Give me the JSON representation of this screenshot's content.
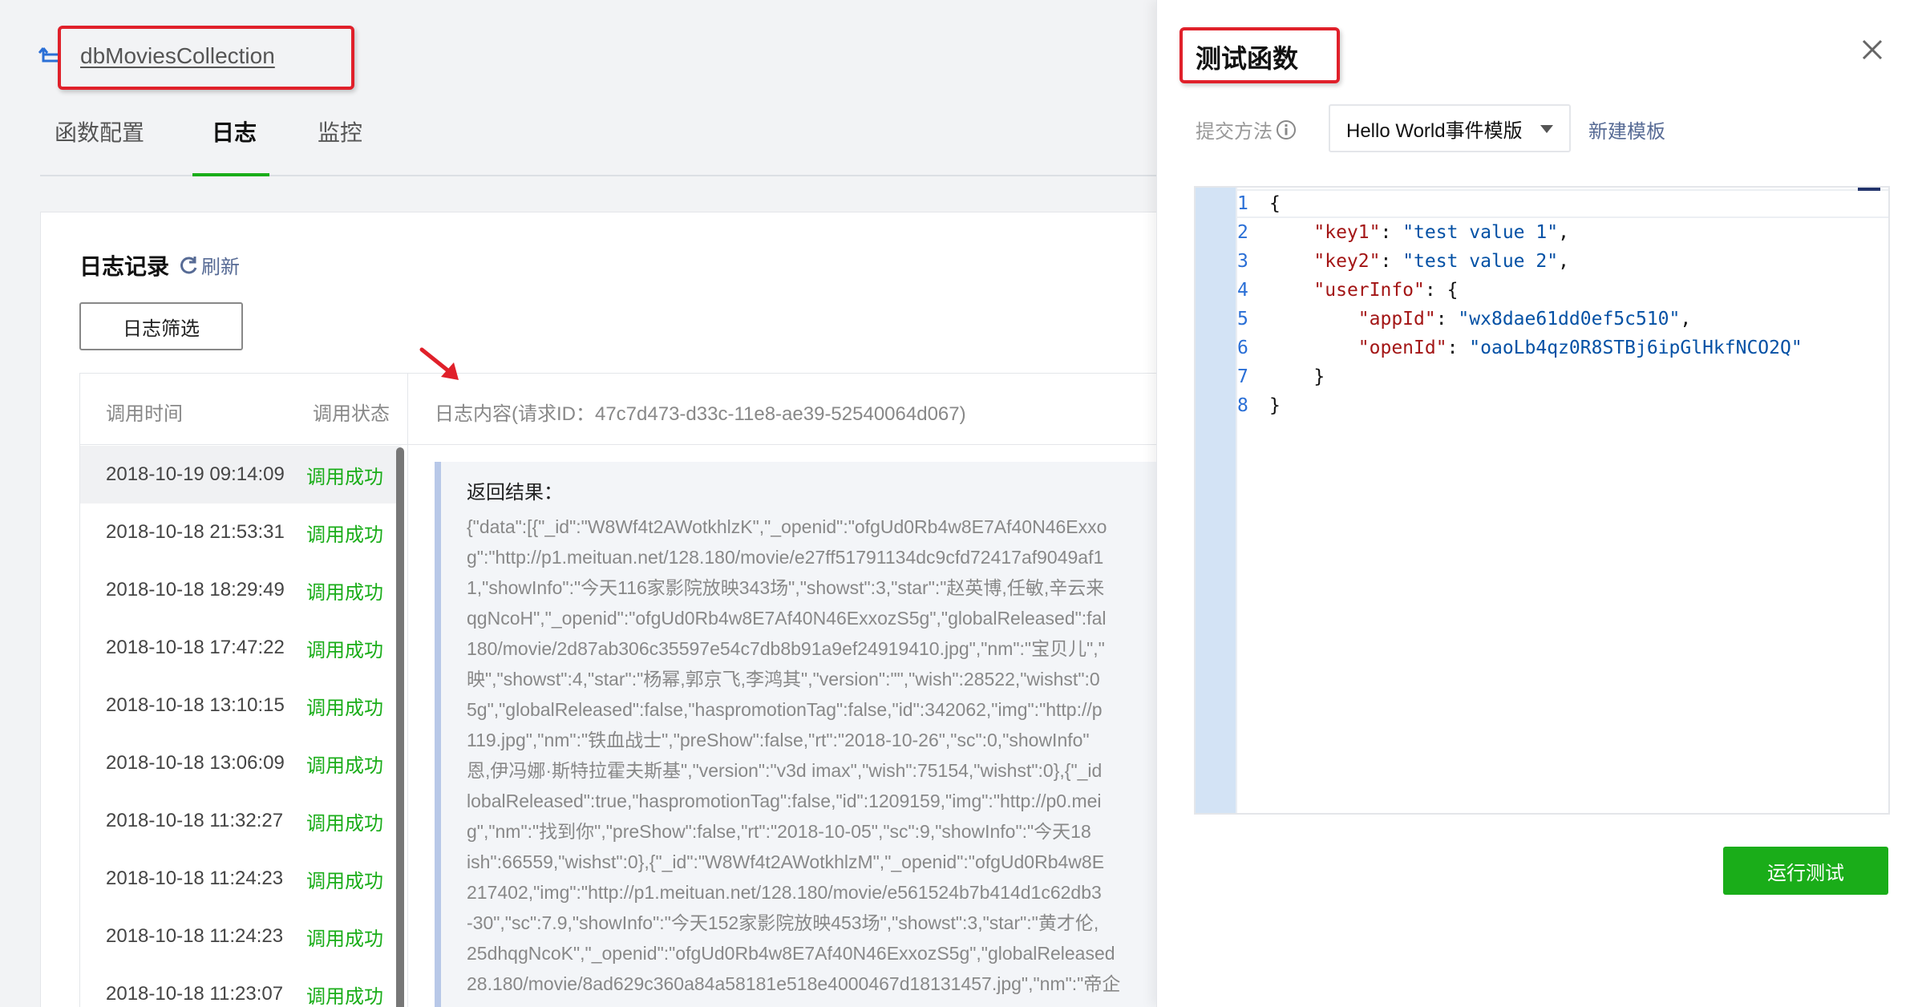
{
  "header": {
    "function_name": "dbMoviesCollection"
  },
  "tabs": [
    {
      "label": "函数配置"
    },
    {
      "label": "日志"
    },
    {
      "label": "监控"
    }
  ],
  "active_tab": "日志",
  "log_section": {
    "title": "日志记录",
    "refresh_label": "刷新",
    "filter_button": "日志筛选",
    "columns": {
      "time": "调用时间",
      "status": "调用状态",
      "content": "日志内容",
      "request_id": "(请求ID：47c7d473-d33c-11e8-ae39-52540064d067)"
    },
    "rows": [
      {
        "time": "2018-10-19 09:14:09",
        "status": "调用成功"
      },
      {
        "time": "2018-10-18 21:53:31",
        "status": "调用成功"
      },
      {
        "time": "2018-10-18 18:29:49",
        "status": "调用成功"
      },
      {
        "time": "2018-10-18 17:47:22",
        "status": "调用成功"
      },
      {
        "time": "2018-10-18 13:10:15",
        "status": "调用成功"
      },
      {
        "time": "2018-10-18 13:06:09",
        "status": "调用成功"
      },
      {
        "time": "2018-10-18 11:32:27",
        "status": "调用成功"
      },
      {
        "time": "2018-10-18 11:24:23",
        "status": "调用成功"
      },
      {
        "time": "2018-10-18 11:24:23",
        "status": "调用成功"
      },
      {
        "time": "2018-10-18 11:23:07",
        "status": "调用成功"
      }
    ],
    "result_label": "返回结果：",
    "result_lines": [
      "{\"data\":[{\"_id\":\"W8Wf4t2AWotkhlzK\",\"_openid\":\"ofgUd0Rb4w8E7Af40N46Exxo",
      "g\":\"http://p1.meituan.net/128.180/movie/e27ff51791134dc9cfd72417af9049af1",
      "1,\"showInfo\":\"今天116家影院放映343场\",\"showst\":3,\"star\":\"赵英博,任敏,辛云来",
      "qgNcoH\",\"_openid\":\"ofgUd0Rb4w8E7Af40N46ExxozS5g\",\"globalReleased\":fal",
      "180/movie/2d87ab306c35597e54c7db8b91a9ef24919410.jpg\",\"nm\":\"宝贝儿\",\"",
      "映\",\"showst\":4,\"star\":\"杨幂,郭京飞,李鸿其\",\"version\":\"\",\"wish\":28522,\"wishst\":0",
      "5g\",\"globalReleased\":false,\"haspromotionTag\":false,\"id\":342062,\"img\":\"http://p",
      "119.jpg\",\"nm\":\"铁血战士\",\"preShow\":false,\"rt\":\"2018-10-26\",\"sc\":0,\"showInfo\"",
      "恩,伊冯娜·斯特拉霍夫斯基\",\"version\":\"v3d imax\",\"wish\":75154,\"wishst\":0},{\"_id",
      "lobalReleased\":true,\"haspromotionTag\":false,\"id\":1209159,\"img\":\"http://p0.mei",
      "g\",\"nm\":\"找到你\",\"preShow\":false,\"rt\":\"2018-10-05\",\"sc\":9,\"showInfo\":\"今天18",
      "ish\":66559,\"wishst\":0},{\"_id\":\"W8Wf4t2AWotkhlzM\",\"_openid\":\"ofgUd0Rb4w8E",
      "217402,\"img\":\"http://p1.meituan.net/128.180/movie/e561524b7b414d1c62db3",
      "-30\",\"sc\":7.9,\"showInfo\":\"今天152家影院放映453场\",\"showst\":3,\"star\":\"黄才伦,",
      "25dhqgNcoK\",\"_openid\":\"ofgUd0Rb4w8E7Af40N46ExxozS5g\",\"globalReleased",
      "28.180/movie/8ad629c360a84a58181e518e4000467d18131457.jpg\",\"nm\":\"帝企"
    ]
  },
  "drawer": {
    "title": "测试函数",
    "submit_method_label": "提交方法",
    "template_select": "Hello World事件模版",
    "new_template_link": "新建模板",
    "run_button": "运行测试",
    "editor_lines": [
      "1",
      "2",
      "3",
      "4",
      "5",
      "6",
      "7",
      "8"
    ],
    "code": {
      "key1": "test value 1",
      "key2": "test value 2",
      "userInfo_key": "userInfo",
      "appId": "wx8dae61dd0ef5c510",
      "openId": "oaoLb4qz0R8STBj6ipGlHkfNCO2Q"
    }
  },
  "colors": {
    "accent_green": "#1aad19",
    "link_blue": "#576b95",
    "annotation_red": "#e0202a"
  }
}
